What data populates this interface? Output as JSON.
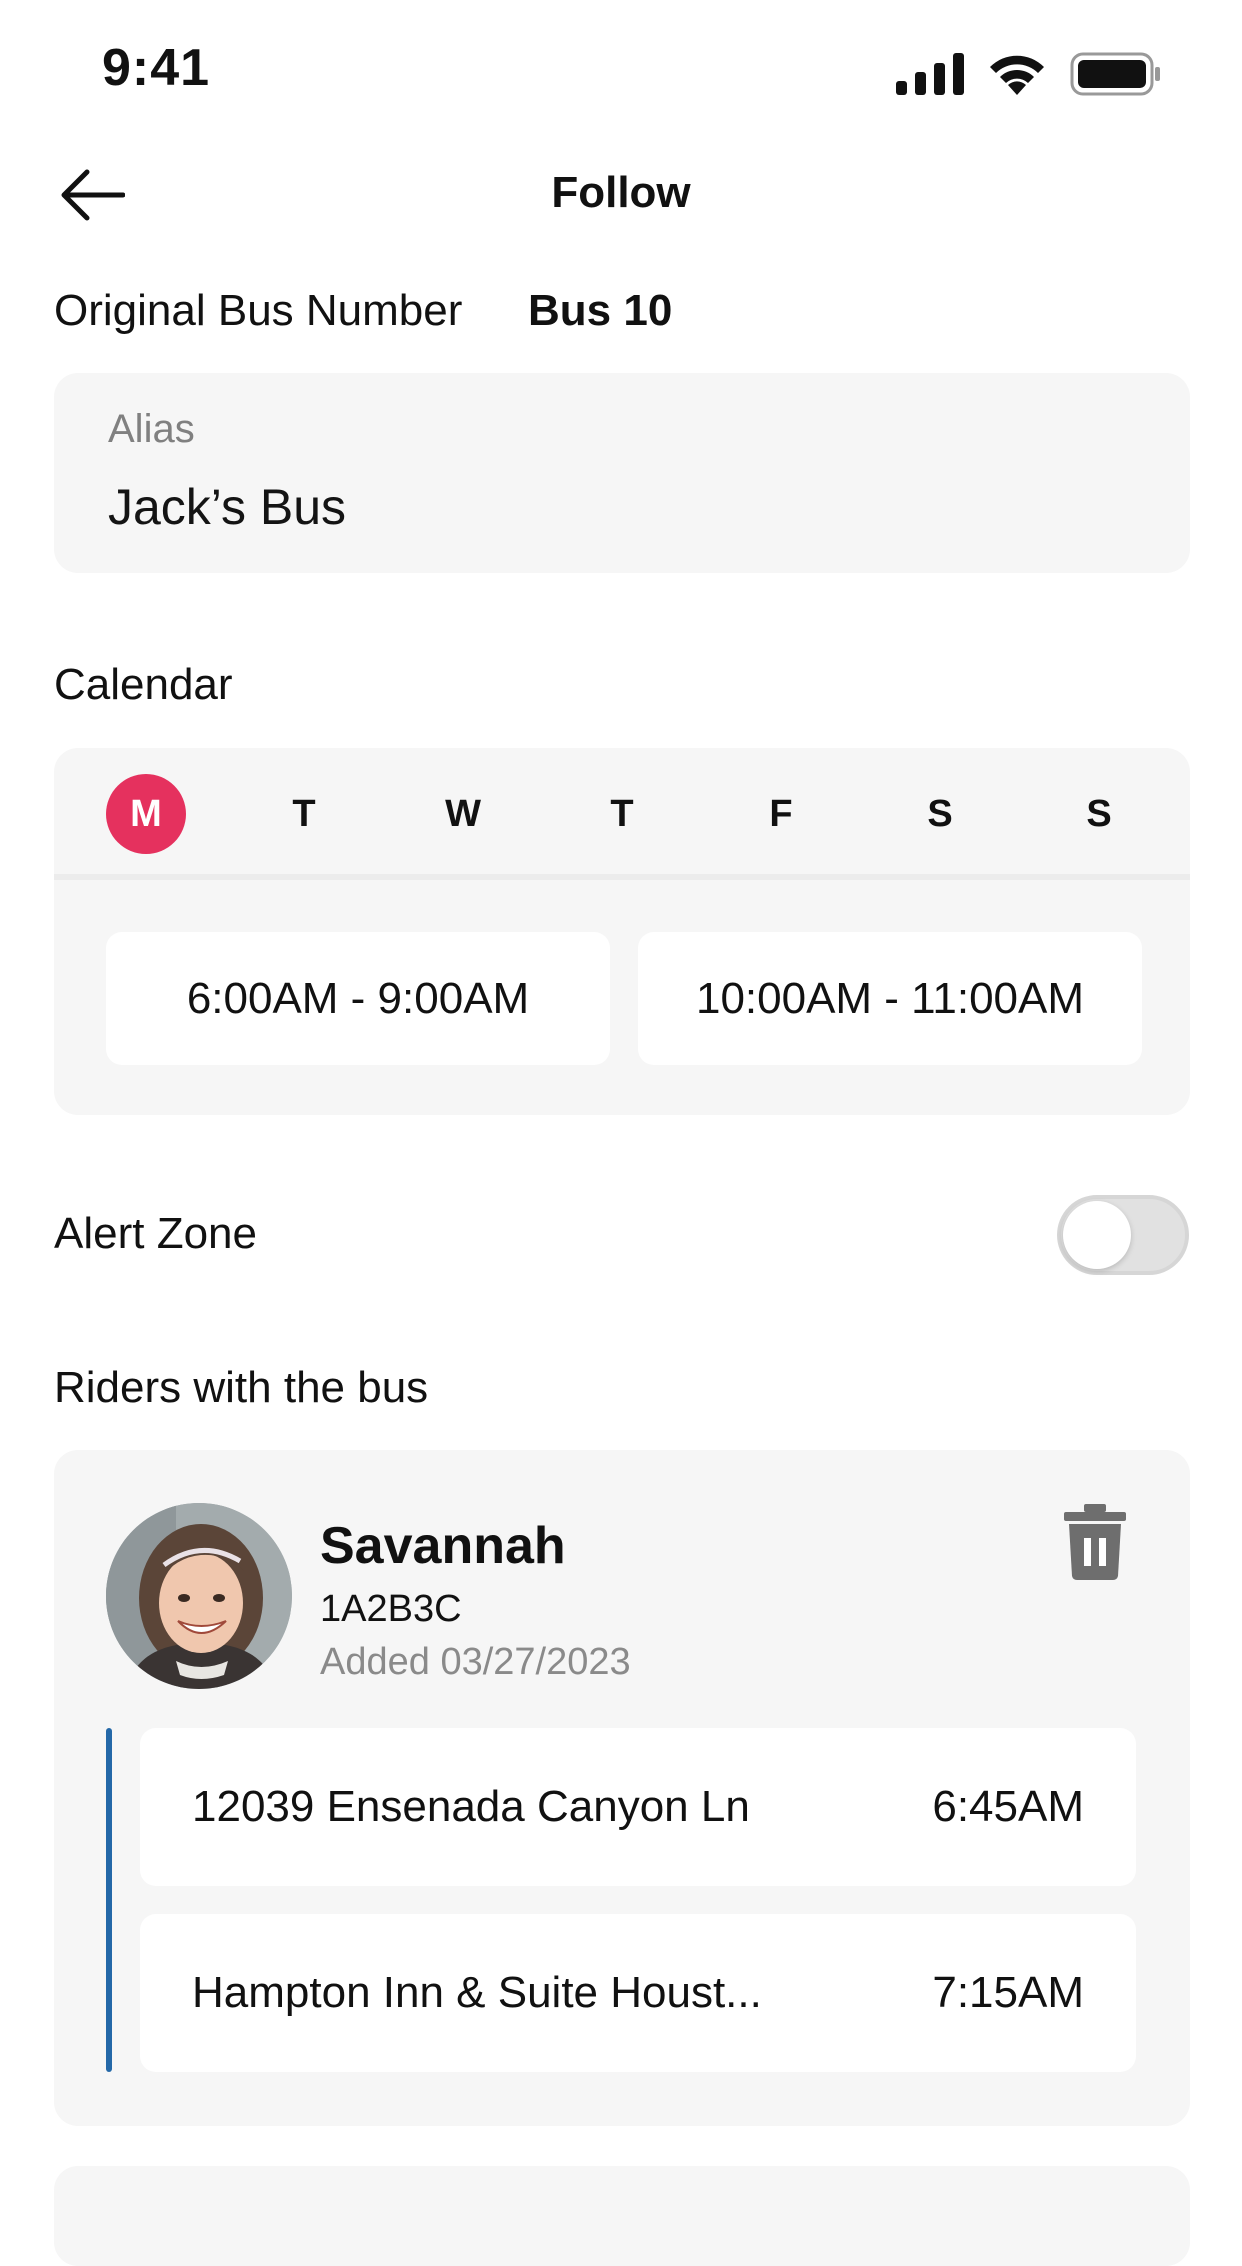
{
  "status_bar": {
    "time": "9:41",
    "icons": [
      "signal-icon",
      "wifi-icon",
      "battery-icon"
    ]
  },
  "header": {
    "title": "Follow",
    "back_icon": "back-arrow-icon"
  },
  "bus": {
    "original_label": "Original Bus Number",
    "original_value": "Bus 10",
    "alias_label": "Alias",
    "alias_value": "Jack’s Bus"
  },
  "calendar": {
    "title": "Calendar",
    "days": [
      "M",
      "T",
      "W",
      "T",
      "F",
      "S",
      "S"
    ],
    "active_day_index": 0,
    "slots": [
      "6:00AM - 9:00AM",
      "10:00AM - 11:00AM"
    ]
  },
  "alert_zone": {
    "label": "Alert Zone",
    "enabled": false
  },
  "riders": {
    "title": "Riders with the bus",
    "items": [
      {
        "name": "Savannah",
        "id": "1A2B3C",
        "added": "Added 03/27/2023",
        "stops": [
          {
            "address": "12039 Ensenada Canyon Ln",
            "time": "6:45AM"
          },
          {
            "address": "Hampton Inn & Suite Houst...",
            "time": "7:15AM"
          }
        ]
      }
    ]
  },
  "colors": {
    "accent": "#e5315e",
    "route": "#2468a8",
    "card_bg": "#f6f6f6"
  }
}
